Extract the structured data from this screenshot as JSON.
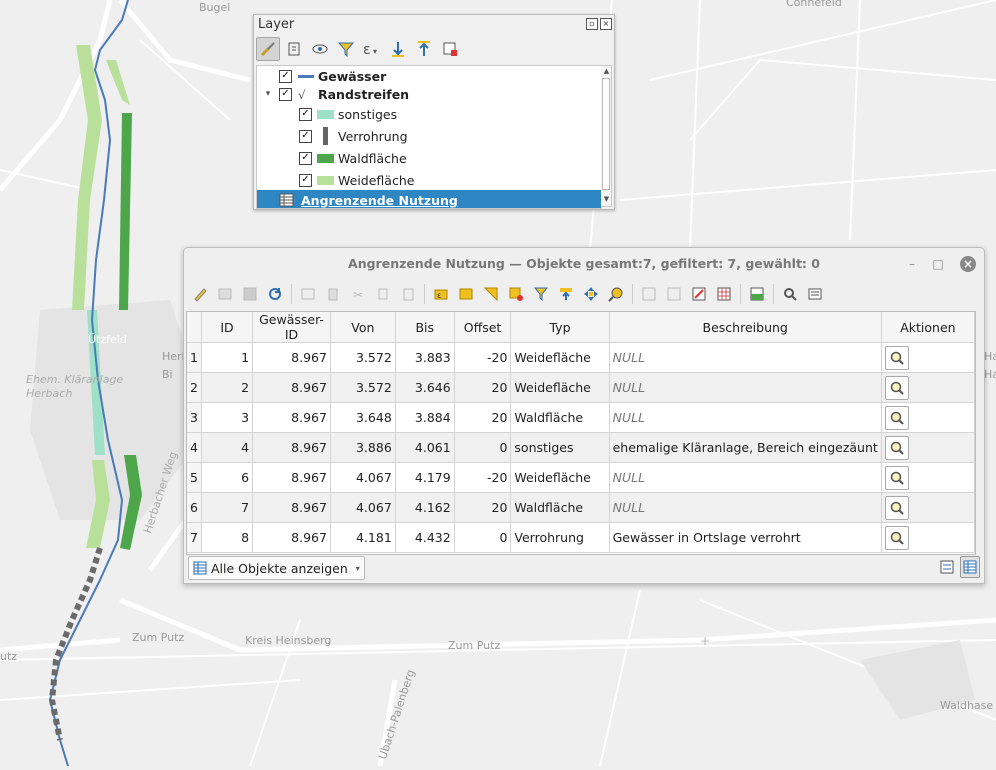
{
  "map": {
    "labels": [
      "Bugel",
      "Connefeld",
      "Ützfeld",
      "Heri",
      "Bi",
      "Ehem. Kläranlage Herbach",
      "Herbacher Weg",
      "Zum Putz",
      "Kreis Heinsberg",
      "Zum Putz",
      "Ubach-Palenberg",
      "Waldhase",
      "utz",
      "Ha",
      "Ha"
    ]
  },
  "layer_panel": {
    "title": "Layer",
    "layers": [
      {
        "label": "Gewässer",
        "checked": true,
        "bold": true,
        "symbol": "line",
        "color": "#4a7ab8"
      },
      {
        "label": "Randstreifen",
        "checked": true,
        "bold": true,
        "symbol": "rule",
        "color": "#555555"
      },
      {
        "label": "sonstiges",
        "checked": true,
        "bold": false,
        "symbol": "fill",
        "color": "#9fe0c8"
      },
      {
        "label": "Verrohrung",
        "checked": true,
        "bold": false,
        "symbol": "bar",
        "color": "#666666"
      },
      {
        "label": "Waldfläche",
        "checked": true,
        "bold": false,
        "symbol": "fill",
        "color": "#4ea64a"
      },
      {
        "label": "Weidefläche",
        "checked": true,
        "bold": false,
        "symbol": "fill",
        "color": "#b9e09a"
      },
      {
        "label": "Angrenzende Nutzung",
        "checked": null,
        "bold": true,
        "symbol": "table",
        "color": "#555555"
      }
    ]
  },
  "attribute_table": {
    "title": "Angrenzende Nutzung — Objekte gesamt:7, gefiltert: 7, gewählt: 0",
    "columns": [
      "ID",
      "Gewässer-ID",
      "Von",
      "Bis",
      "Offset",
      "Typ",
      "Beschreibung",
      "Aktionen"
    ],
    "rows": [
      {
        "row": "1",
        "id": "1",
        "gid": "8.967",
        "von": "3.572",
        "bis": "3.883",
        "offset": "-20",
        "typ": "Weidefläche",
        "desc": "NULL"
      },
      {
        "row": "2",
        "id": "2",
        "gid": "8.967",
        "von": "3.572",
        "bis": "3.646",
        "offset": "20",
        "typ": "Weidefläche",
        "desc": "NULL"
      },
      {
        "row": "3",
        "id": "3",
        "gid": "8.967",
        "von": "3.648",
        "bis": "3.884",
        "offset": "20",
        "typ": "Waldfläche",
        "desc": "NULL"
      },
      {
        "row": "4",
        "id": "4",
        "gid": "8.967",
        "von": "3.886",
        "bis": "4.061",
        "offset": "0",
        "typ": "sonstiges",
        "desc": "ehemalige Kläranlage, Bereich eingezäunt"
      },
      {
        "row": "5",
        "id": "6",
        "gid": "8.967",
        "von": "4.067",
        "bis": "4.179",
        "offset": "-20",
        "typ": "Weidefläche",
        "desc": "NULL"
      },
      {
        "row": "6",
        "id": "7",
        "gid": "8.967",
        "von": "4.067",
        "bis": "4.162",
        "offset": "20",
        "typ": "Waldfläche",
        "desc": "NULL"
      },
      {
        "row": "7",
        "id": "8",
        "gid": "8.967",
        "von": "4.181",
        "bis": "4.432",
        "offset": "0",
        "typ": "Verrohrung",
        "desc": "Gewässer in Ortslage verrohrt"
      }
    ],
    "filter_button": "Alle Objekte anzeigen"
  }
}
